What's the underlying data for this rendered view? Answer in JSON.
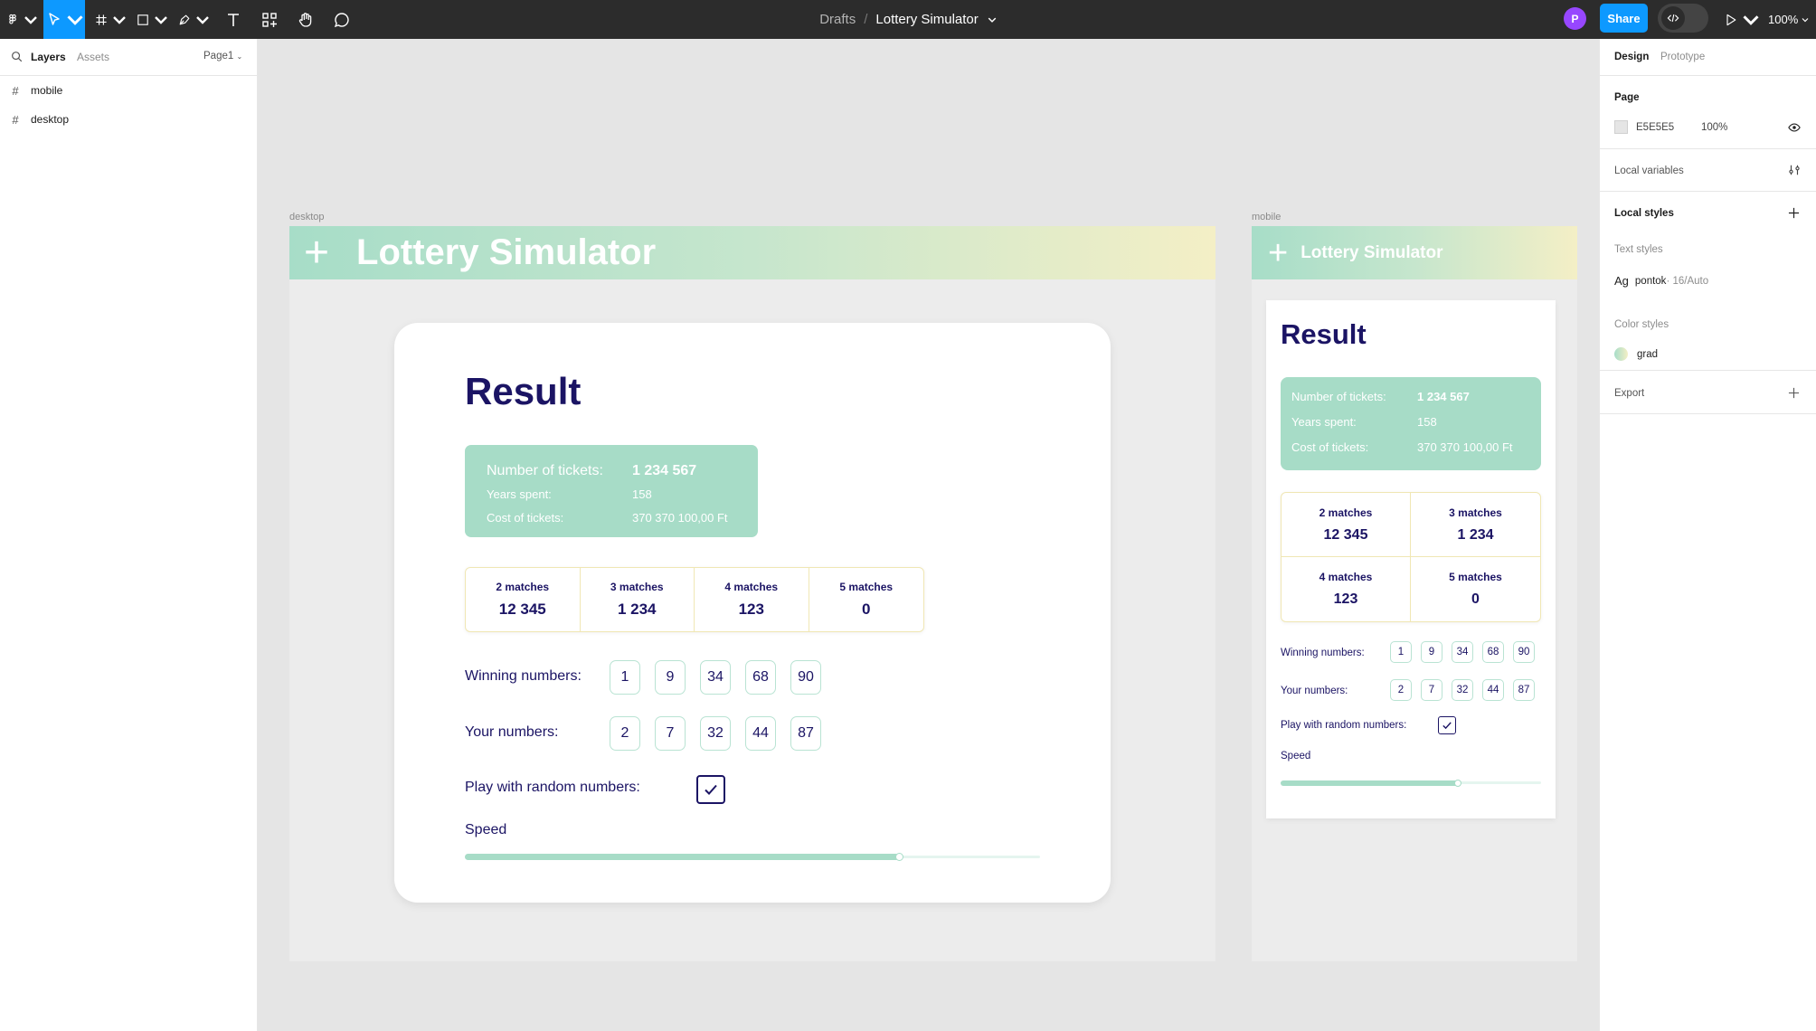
{
  "toolbar": {
    "breadcrumb_parent": "Drafts",
    "breadcrumb_sep": "/",
    "file_name": "Lottery Simulator",
    "avatar_initial": "P",
    "share_label": "Share",
    "zoom": "100%",
    "tool_icons": [
      "figma-menu-icon",
      "move-tool-icon",
      "frame-tool-icon",
      "shape-tool-icon",
      "pen-tool-icon",
      "text-tool-icon",
      "resources-icon",
      "hand-tool-icon",
      "comment-icon",
      "code-icon",
      "present-icon"
    ]
  },
  "left_panel": {
    "tab_layers": "Layers",
    "tab_assets": "Assets",
    "page_select": "Page1",
    "layers": [
      {
        "name": "mobile"
      },
      {
        "name": "desktop"
      }
    ]
  },
  "right_panel": {
    "tab_design": "Design",
    "tab_prototype": "Prototype",
    "page_heading": "Page",
    "page_color": "E5E5E5",
    "page_opacity": "100%",
    "local_variables": "Local variables",
    "local_styles": "Local styles",
    "text_styles_heading": "Text styles",
    "text_style_icon": "Ag",
    "text_style_name": "pontok",
    "text_style_meta": " · 16/Auto",
    "color_styles_heading": "Color styles",
    "color_style_name": "grad",
    "export": "Export"
  },
  "desktop": {
    "frame_label": "desktop",
    "header_plus": "+",
    "header_title": "Lottery Simulator",
    "result_title": "Result",
    "stats": [
      {
        "label": "Number of tickets:",
        "value": "1 234 567"
      },
      {
        "label": "Years spent:",
        "value": "158"
      },
      {
        "label": "Cost of tickets:",
        "value": "370 370 100,00 Ft"
      }
    ],
    "matches": [
      {
        "label": "2 matches",
        "value": "12 345"
      },
      {
        "label": "3 matches",
        "value": "1 234"
      },
      {
        "label": "4 matches",
        "value": "123"
      },
      {
        "label": "5 matches",
        "value": "0"
      }
    ],
    "winning_label": "Winning numbers:",
    "winning_numbers": [
      "1",
      "9",
      "34",
      "68",
      "90"
    ],
    "your_label": "Your numbers:",
    "your_numbers": [
      "2",
      "7",
      "32",
      "44",
      "87"
    ],
    "random_label": "Play with random numbers:",
    "random_checked": true,
    "speed_label": "Speed",
    "speed_level": 0.755
  },
  "mobile": {
    "frame_label": "mobile",
    "header_plus": "+",
    "header_title": "Lottery Simulator",
    "result_title": "Result",
    "stats": [
      {
        "label": "Number of tickets:",
        "value": "1 234 567"
      },
      {
        "label": "Years spent:",
        "value": "158"
      },
      {
        "label": "Cost of tickets:",
        "value": "370 370 100,00 Ft"
      }
    ],
    "matches": [
      {
        "label": "2 matches",
        "value": "12 345"
      },
      {
        "label": "3 matches",
        "value": "1 234"
      },
      {
        "label": "4 matches",
        "value": "123"
      },
      {
        "label": "5 matches",
        "value": "0"
      }
    ],
    "winning_label": "Winning numbers:",
    "winning_numbers": [
      "1",
      "9",
      "34",
      "68",
      "90"
    ],
    "your_label": "Your numbers:",
    "your_numbers": [
      "2",
      "7",
      "32",
      "44",
      "87"
    ],
    "random_label": "Play with random numbers:",
    "random_checked": true,
    "speed_label": "Speed",
    "speed_level": 0.68
  },
  "colors": {
    "toolbar_bg": "#2c2c2c",
    "accent_blue": "#0d99ff",
    "mint": "#a7dcc7",
    "yellow": "#f4efc6",
    "navy": "#1b1464",
    "canvas": "#e5e5e5"
  }
}
